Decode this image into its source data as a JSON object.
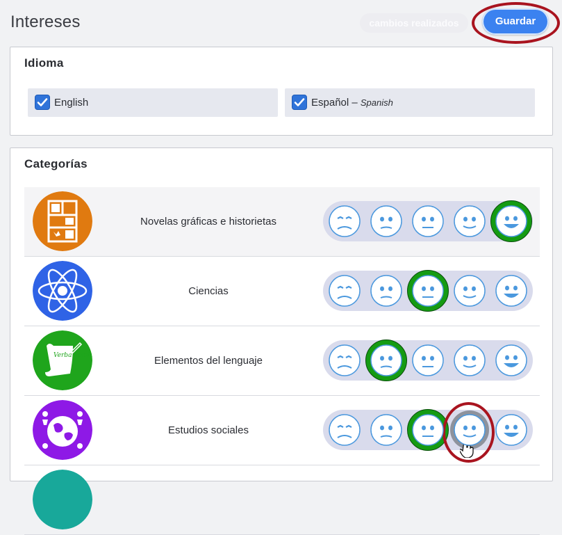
{
  "header": {
    "title": "Intereses",
    "changes_label": "cambios realizados",
    "save_label": "Guardar"
  },
  "language_section": {
    "title": "Idioma",
    "options": [
      {
        "label": "English",
        "sub_label": "",
        "checked": true
      },
      {
        "label": "Español – ",
        "sub_label": "Spanish",
        "checked": true
      }
    ]
  },
  "categories_section": {
    "title": "Categorías",
    "rating_scale": [
      "very-sad-face",
      "sad-face",
      "neutral-face",
      "slightly-happy-face",
      "very-happy-face"
    ],
    "items": [
      {
        "name": "Novelas gráficas e historietas",
        "icon": "graphic-novel-icon",
        "icon_color": "#e07a10",
        "rating": 5
      },
      {
        "name": "Ciencias",
        "icon": "atom-icon",
        "icon_color": "#2f63e6",
        "rating": 3
      },
      {
        "name": "Elementos del lenguaje",
        "icon": "scroll-quill-icon",
        "icon_color": "#1fa51c",
        "icon_text": "Verba hominum",
        "rating": 2
      },
      {
        "name": "Estudios sociales",
        "icon": "globe-people-icon",
        "icon_color": "#8e19e6",
        "rating": 3,
        "hovered": 4
      }
    ]
  },
  "colors": {
    "accent": "#3b82f0",
    "selected_face": "#159b13",
    "annotation": "#a9141f"
  }
}
